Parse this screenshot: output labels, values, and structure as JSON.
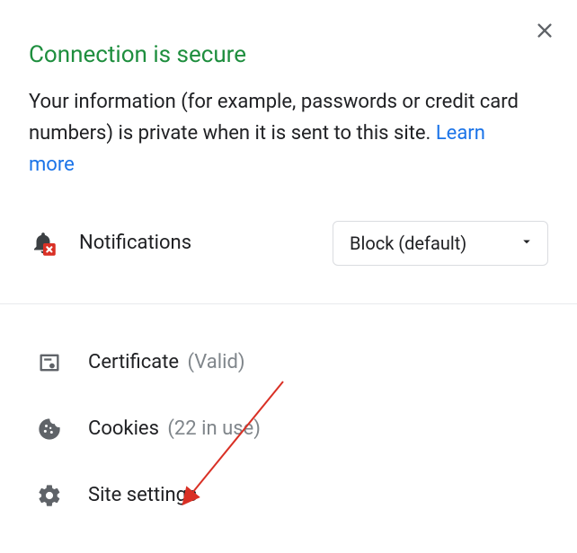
{
  "header": {
    "title": "Connection is secure",
    "description_pre": "Your information (for example, passwords or credit card numbers) is private when it is sent to this site. ",
    "learn_more": "Learn more"
  },
  "permission": {
    "label": "Notifications",
    "selected": "Block (default)"
  },
  "rows": {
    "certificate": {
      "label": "Certificate",
      "sub": "(Valid)"
    },
    "cookies": {
      "label": "Cookies",
      "sub": "(22 in use)"
    },
    "site_settings": {
      "label": "Site settings"
    }
  },
  "colors": {
    "accent_green": "#1e8e3e",
    "link_blue": "#1a73e8",
    "icon_grey": "#5f6368",
    "arrow_red": "#d93025"
  }
}
